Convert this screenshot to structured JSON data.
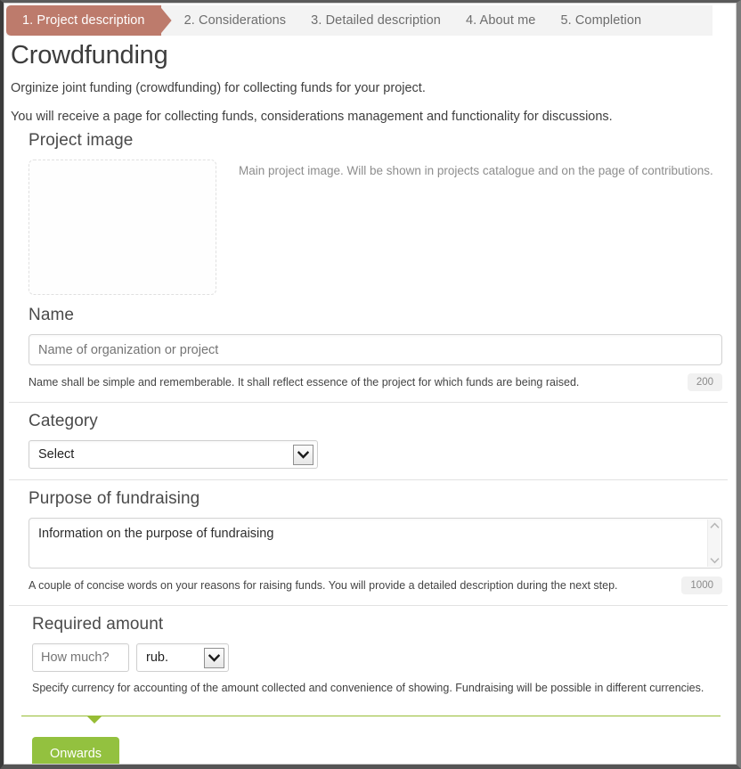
{
  "tabs": [
    {
      "label": "1. Project description",
      "active": true
    },
    {
      "label": "2. Considerations",
      "active": false
    },
    {
      "label": "3. Detailed description",
      "active": false
    },
    {
      "label": "4. About me",
      "active": false
    },
    {
      "label": "5. Completion",
      "active": false
    }
  ],
  "header": {
    "title": "Crowdfunding",
    "intro_line_1": "Orginize joint funding (crowdfunding) for collecting funds for your project.",
    "intro_line_2": "You will receive a page for collecting funds, considerations management and functionality for discussions."
  },
  "project_image": {
    "section_title": "Project image",
    "hint": "Main project image. Will be shown in projects catalogue and on the page of contributions."
  },
  "name": {
    "section_title": "Name",
    "placeholder": "Name of organization or project",
    "value": "",
    "helper": "Name shall be simple and rememberable. It shall reflect essence of the project for which funds are being raised.",
    "counter": "200"
  },
  "category": {
    "section_title": "Category",
    "selected": "Select",
    "arrow_icon": "chevron-down-icon"
  },
  "purpose": {
    "section_title": "Purpose of fundraising",
    "placeholder": "Information on the purpose of fundraising",
    "value": "",
    "helper": "A couple of concise words on your reasons for raising funds. You will provide a detailed description during the next step.",
    "counter": "1000",
    "scroll_up_icon": "chevron-up-icon",
    "scroll_down_icon": "chevron-down-icon"
  },
  "amount": {
    "section_title": "Required amount",
    "placeholder": "How much?",
    "value": "",
    "currency_selected": "rub.",
    "currency_arrow_icon": "chevron-down-icon",
    "helper": "Specify currency for accounting of the amount collected and convenience of showing. Fundraising will be possible in different currencies."
  },
  "footer": {
    "submit_label": "Onwards"
  },
  "colors": {
    "active_tab": "#bd7b6c",
    "tabbar_bg": "#f3f3f3",
    "submit_button": "#93c13f",
    "green_rule": "#97bd35",
    "counter_badge_bg": "#f1f1f1"
  }
}
